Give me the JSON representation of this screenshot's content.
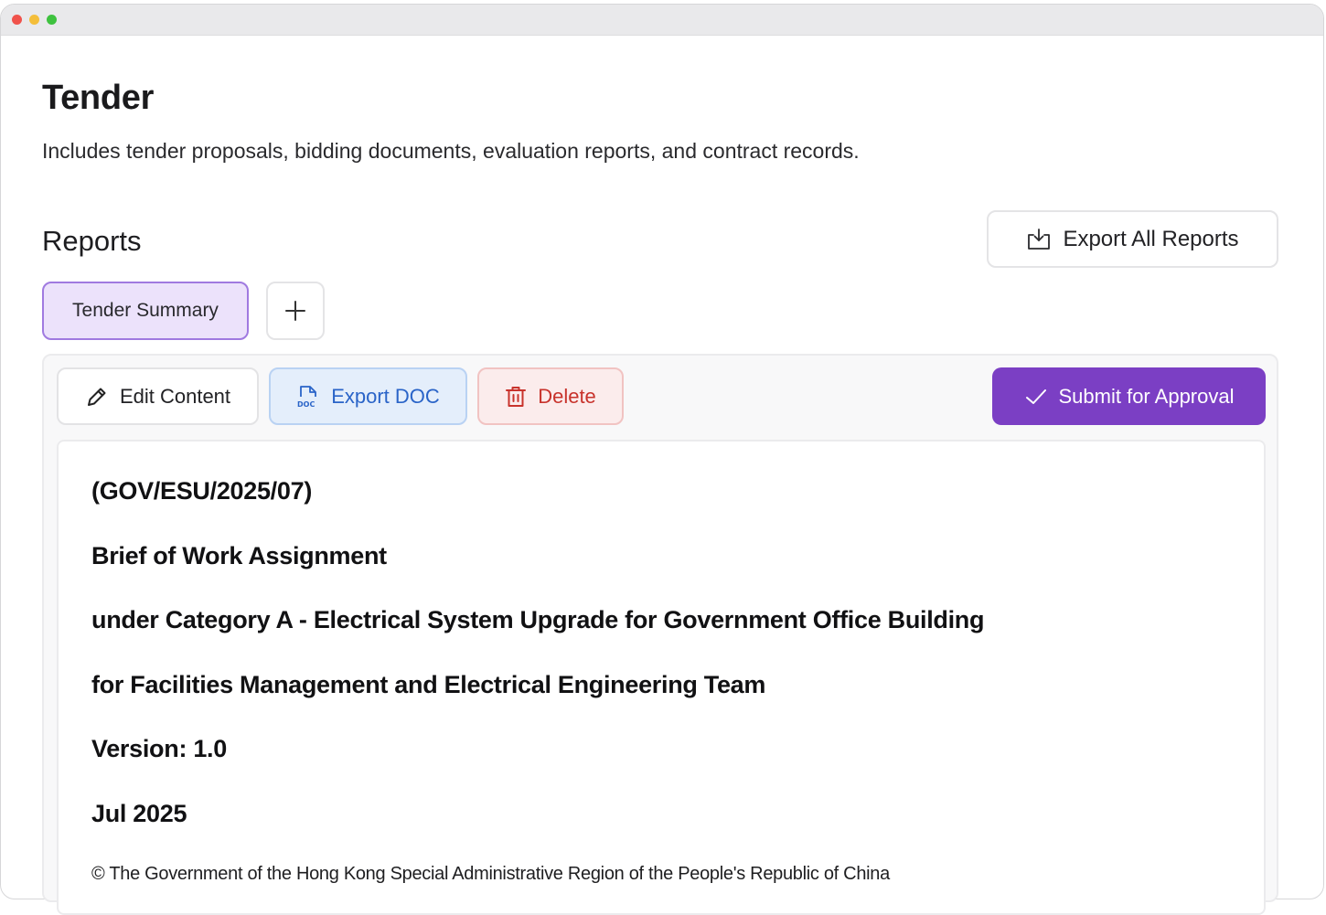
{
  "page": {
    "title": "Tender",
    "description": "Includes tender proposals, bidding documents, evaluation reports, and contract records."
  },
  "reports": {
    "section_title": "Reports",
    "export_all_label": "Export All Reports",
    "tabs": [
      {
        "label": "Tender Summary",
        "active": true
      }
    ],
    "add_tab_symbol": "+"
  },
  "toolbar": {
    "edit_label": "Edit Content",
    "export_doc_label": "Export DOC",
    "delete_label": "Delete",
    "submit_label": "Submit for Approval"
  },
  "document": {
    "lines": [
      "(GOV/ESU/2025/07)",
      "Brief of Work Assignment",
      "under Category A - Electrical System Upgrade for Government Office Building",
      "for Facilities Management and Electrical Engineering Team",
      "Version: 1.0",
      "Jul 2025"
    ],
    "copyright": "© The Government of the Hong Kong Special Administrative Region of the People's Republic of China"
  },
  "icons": {
    "export_all": "download-tray-icon",
    "add": "plus-icon",
    "edit": "pencil-icon",
    "export_doc": "doc-file-icon",
    "delete": "trash-icon",
    "submit": "check-icon"
  },
  "colors": {
    "accent_purple": "#7b3fc4",
    "tab_active_bg": "#ece2fb",
    "tab_active_border": "#a07ae0",
    "export_doc_blue": "#2a64c8",
    "delete_red": "#c8332c"
  }
}
